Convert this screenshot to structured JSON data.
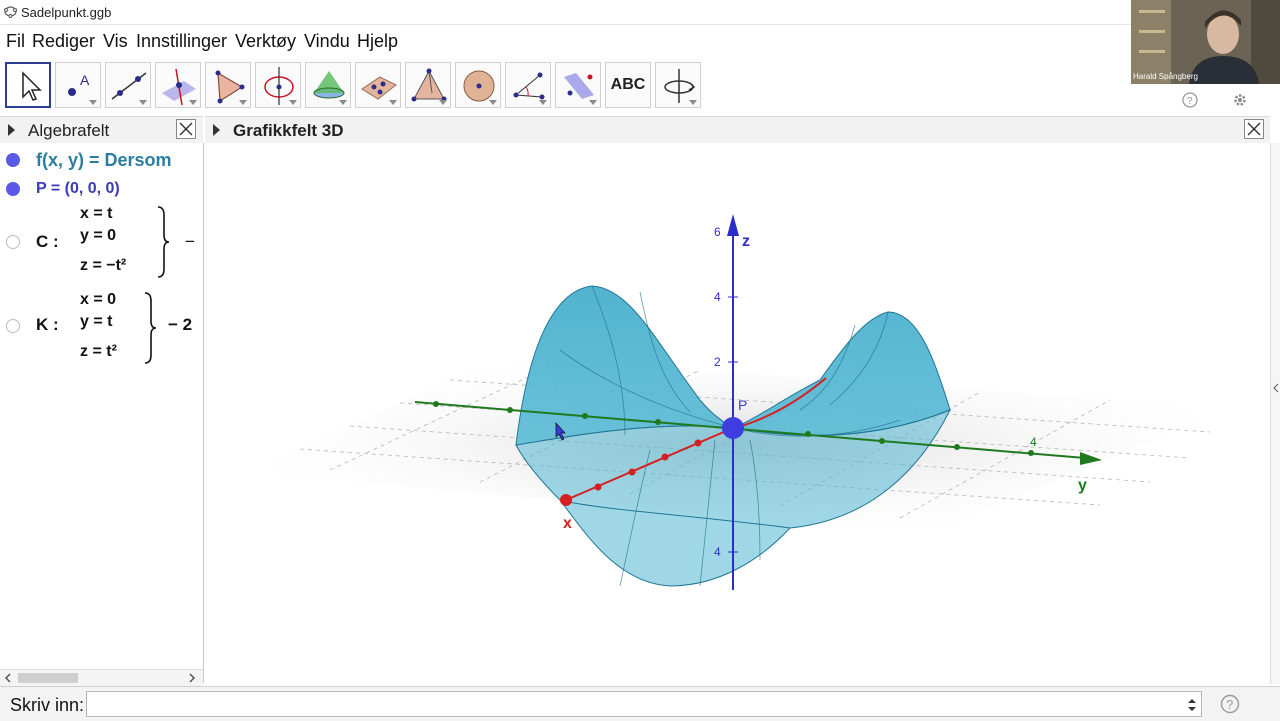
{
  "window": {
    "title": "Sadelpunkt.ggb"
  },
  "menu": [
    "Fil",
    "Rediger",
    "Vis",
    "Innstillinger",
    "Verktøy",
    "Vindu",
    "Hjelp"
  ],
  "toolbar": {
    "tools": [
      "move",
      "point",
      "line",
      "perpendicular-line",
      "polygon",
      "circle",
      "cone",
      "plane-through-points",
      "pyramid",
      "sphere",
      "angle",
      "reflect",
      "text",
      "rotate-view"
    ],
    "text_tool_label": "ABC"
  },
  "webcam": {
    "name": "Harald Spångberg"
  },
  "algebra_panel": {
    "title": "Algebrafelt",
    "items": [
      {
        "label": "f(x, y) = Dersom",
        "color": "#2a7fa0",
        "dot": "filled"
      },
      {
        "label": "P = (0, 0, 0)",
        "color": "#3b3bb8",
        "dot": "filled"
      },
      {
        "name": "C :",
        "lines": [
          "x = t",
          "y = 0",
          "z = −t²"
        ],
        "range": "−",
        "dot": "hollow"
      },
      {
        "name": "K :",
        "lines": [
          "x = 0",
          "y = t",
          "z = t²"
        ],
        "range": "− 2",
        "dot": "hollow"
      }
    ]
  },
  "graphics_panel": {
    "title": "Grafikkfelt 3D",
    "axis_labels": {
      "x": "x",
      "y": "y",
      "z": "z"
    },
    "z_ticks": [
      "6",
      "4",
      "2",
      "4"
    ],
    "y_ticks": [
      "4"
    ],
    "point_label": "P",
    "colors": {
      "surface": "#35a7c8",
      "x_axis": "#d42020",
      "y_axis": "#1f7a1f",
      "z_axis": "#2d2dc9",
      "point": "#3e3ee0"
    }
  },
  "input_bar": {
    "label": "Skriv inn:",
    "value": ""
  }
}
